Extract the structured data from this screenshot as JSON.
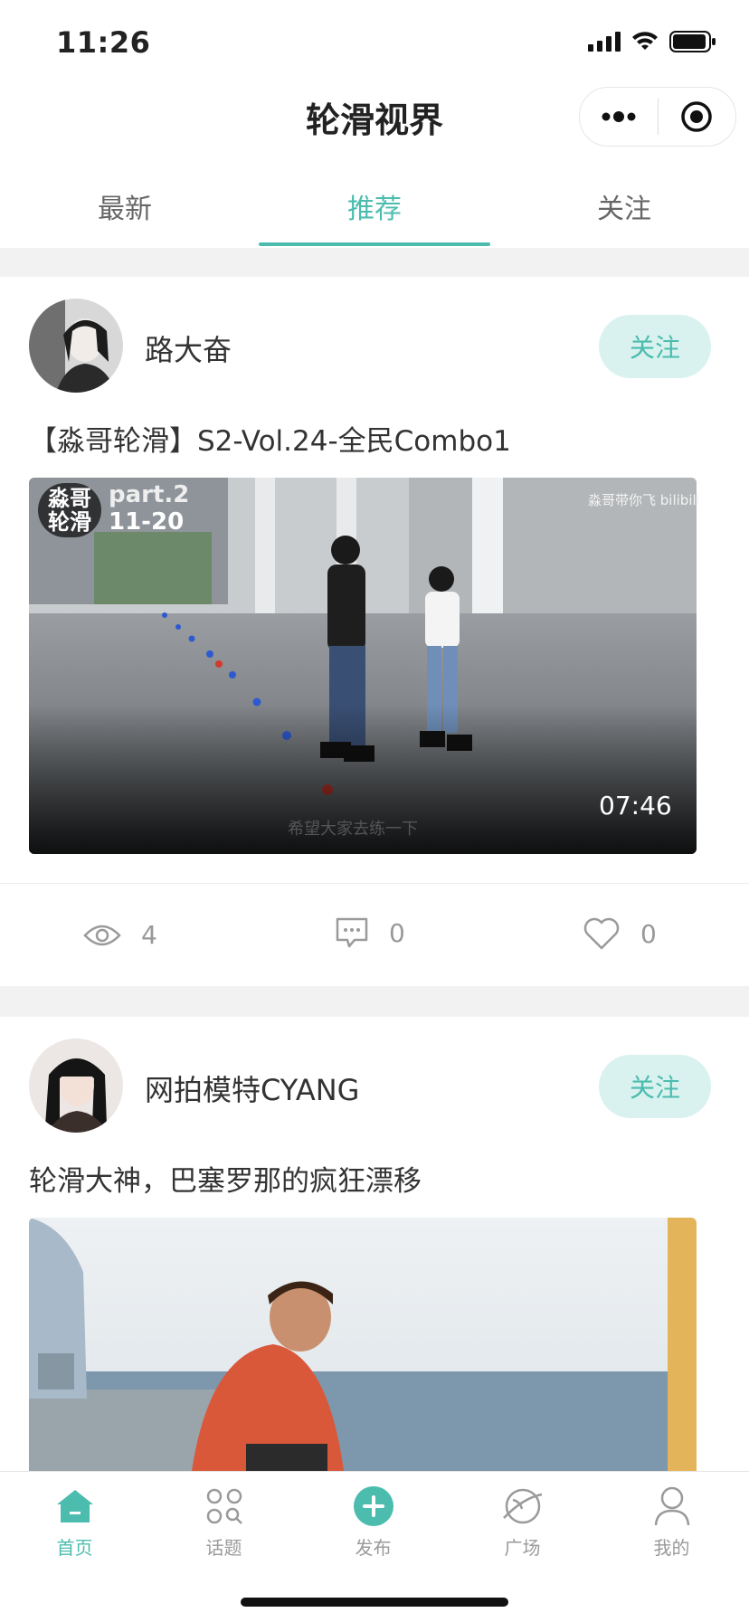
{
  "status_bar": {
    "time": "11:26"
  },
  "nav": {
    "title": "轮滑视界"
  },
  "tabs": [
    {
      "label": "最新"
    },
    {
      "label": "推荐"
    },
    {
      "label": "关注"
    }
  ],
  "active_tab": "推荐",
  "accent_color": "#4bbcae",
  "posts": [
    {
      "author": "路大奋",
      "follow_label": "关注",
      "title": "【淼哥轮滑】S2-Vol.24-全民Combo1",
      "video": {
        "overlay_logo": "淼哥轮滑",
        "overlay_part": "part.2",
        "overlay_date": "11-20",
        "watermark": "淼哥带你飞 bilibili",
        "subtitle": "希望大家去练一下",
        "duration": "07:46"
      },
      "stats": {
        "views": "4",
        "comments": "0",
        "likes": "0"
      }
    },
    {
      "author": "网拍模特CYANG",
      "follow_label": "关注",
      "title": "轮滑大神，巴塞罗那的疯狂漂移"
    }
  ],
  "tabbar": [
    {
      "label": "首页",
      "icon": "home-icon"
    },
    {
      "label": "话题",
      "icon": "topics-icon"
    },
    {
      "label": "发布",
      "icon": "publish-plus-icon"
    },
    {
      "label": "广场",
      "icon": "planet-icon"
    },
    {
      "label": "我的",
      "icon": "profile-icon"
    }
  ]
}
